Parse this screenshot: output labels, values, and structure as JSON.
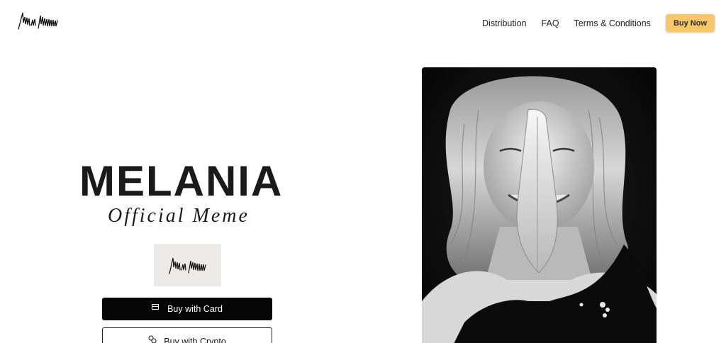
{
  "header": {
    "nav": [
      {
        "label": "Distribution"
      },
      {
        "label": "FAQ"
      },
      {
        "label": "Terms & Conditions"
      }
    ],
    "buy_now_label": "Buy Now",
    "accent_color": "#f6c86b"
  },
  "hero": {
    "title": "MELANIA",
    "subtitle": "Official Meme",
    "buy_card_label": "Buy with Card",
    "buy_crypto_label": "Buy with Crypto",
    "card_icon": "credit-card-icon",
    "crypto_icon": "coins-icon"
  },
  "photo": {
    "style": "black-and-white portrait"
  }
}
